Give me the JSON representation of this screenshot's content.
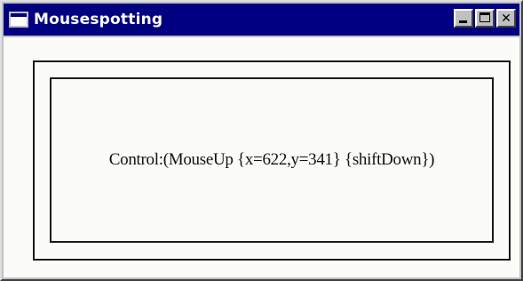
{
  "window": {
    "title": "Mousespotting",
    "title_icon": "window-app-icon",
    "caption_buttons": {
      "minimize_icon": "minimize-icon",
      "maximize_icon": "maximize-icon",
      "close_icon": "close-icon",
      "close_glyph": "✕"
    }
  },
  "content": {
    "event_text": "Control:(MouseUp {x=622,y=341} {shiftDown})"
  },
  "colors": {
    "titlebar": "#000080",
    "title_text": "#ffffff",
    "chrome": "#c0c0c0",
    "client_bg": "#fbfbf8",
    "frame_border": "#1a1a1a"
  }
}
